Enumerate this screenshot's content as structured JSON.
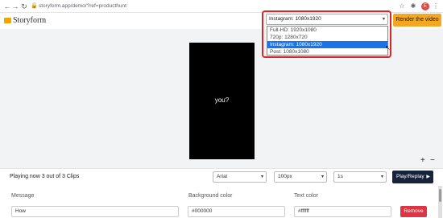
{
  "browser": {
    "url": "storyform.app/demo/?ref=producthunt",
    "avatar_letter": "E"
  },
  "app": {
    "logo_text": "Storyform",
    "render_label": "Render the video",
    "accent": "#f5a623"
  },
  "format": {
    "selected": "Instagram: 1080x1920",
    "options": [
      "Full-HD: 1920x1080",
      "720p: 1280x720",
      "Instagram: 1080x1920",
      "Post: 1080x1080"
    ],
    "highlight_color": "#d9262b"
  },
  "preview": {
    "caption": "you?"
  },
  "zoom": {
    "plus": "+",
    "minus": "−"
  },
  "controls": {
    "clip_status": "Playing now 3 out of 3 Clips",
    "font": "Arial",
    "size": "100px",
    "duration": "1s",
    "play_label": "Play/Replay"
  },
  "form": {
    "message_label": "Message",
    "message_value": "How",
    "bg_label": "Background color",
    "bg_value": "#000000",
    "text_label": "Text color",
    "text_value": "#ffffff",
    "remove_label": "Remove"
  }
}
